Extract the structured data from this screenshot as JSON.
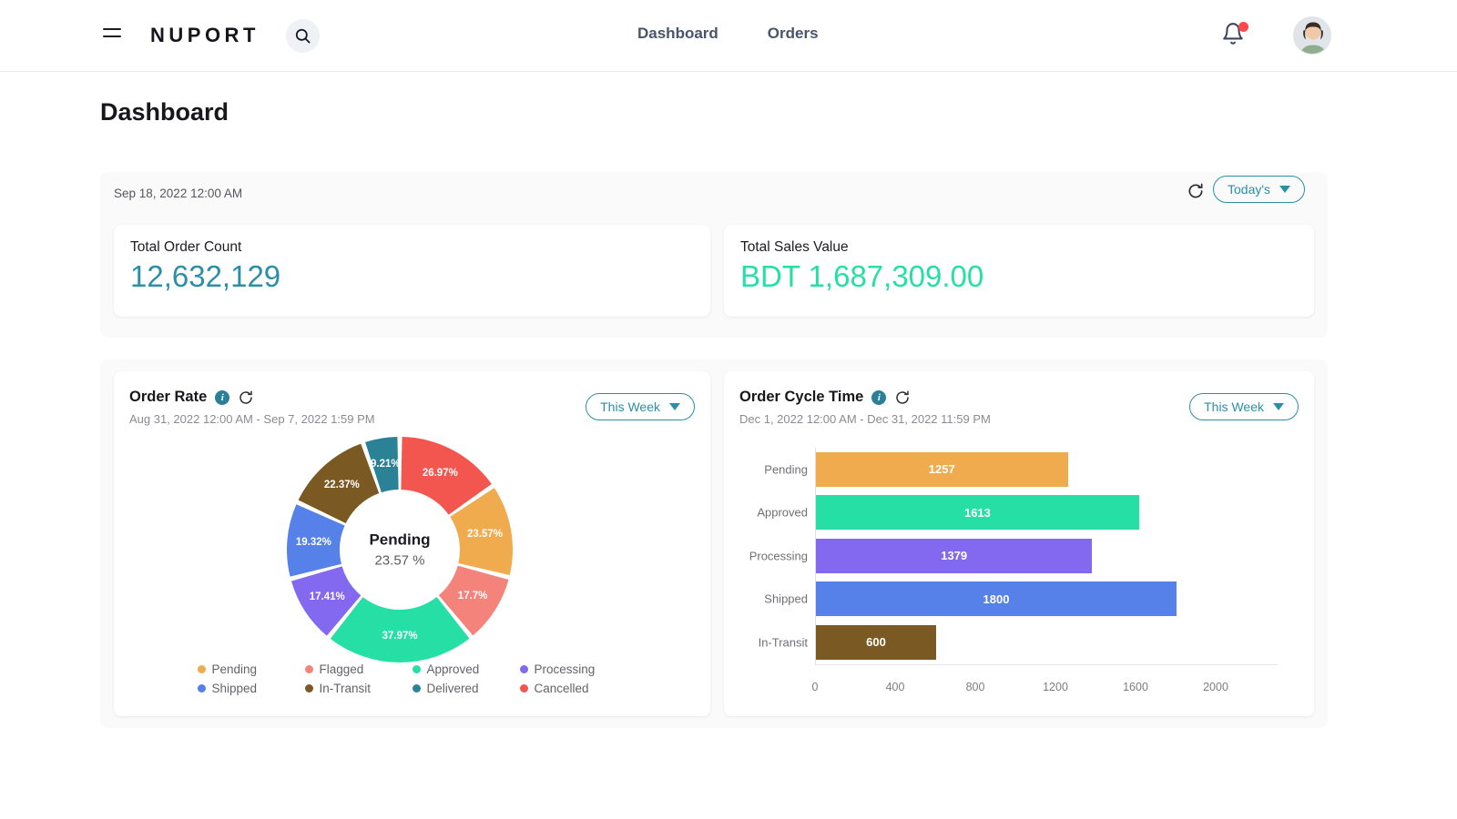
{
  "topbar": {
    "menu_icon": "hamburger-icon",
    "brand": "NUPORT",
    "search_icon": "search-icon",
    "nav": [
      {
        "label": "Dashboard"
      },
      {
        "label": "Orders"
      }
    ],
    "bell_icon": "bell-icon",
    "avatar_icon": "user-avatar"
  },
  "page": {
    "title": "Dashboard"
  },
  "summary": {
    "date": "Sep 18, 2022 12:00 AM",
    "refresh_icon": "refresh-icon",
    "range_filter": "Today's",
    "cards": [
      {
        "label": "Total Order Count",
        "value": "12,632,129",
        "color": "#2b8fa8"
      },
      {
        "label": "Total Sales Value",
        "value": "BDT 1,687,309.00",
        "color": "#25dfa4"
      }
    ]
  },
  "order_rate": {
    "title": "Order Rate",
    "info_icon": "info-icon",
    "refresh_icon": "refresh-icon",
    "subtitle": "Aug 31, 2022 12:00 AM - Sep 7, 2022 1:59 PM",
    "range_filter": "This Week",
    "center": {
      "label": "Pending",
      "value": "23.57 %"
    }
  },
  "order_cycle": {
    "title": "Order Cycle Time",
    "info_icon": "info-icon",
    "refresh_icon": "refresh-icon",
    "subtitle": "Dec 1, 2022 12:00 AM - Dec 31, 2022 11:59 PM",
    "range_filter": "This Week"
  },
  "chart_data": [
    {
      "type": "pie",
      "title": "Order Rate",
      "variant": "donut",
      "center_label": "Pending",
      "center_value": "23.57 %",
      "legend_position": "bottom",
      "labels": [
        "Cancelled",
        "Pending",
        "Flagged",
        "Approved",
        "Processing",
        "Shipped",
        "In-Transit",
        "Delivered"
      ],
      "values": [
        26.97,
        23.57,
        17.7,
        37.97,
        17.41,
        19.32,
        22.37,
        9.21
      ],
      "value_labels": [
        "26.97%",
        "23.57%",
        "17.7%",
        "37.97%",
        "17.41%",
        "19.32%",
        "22.37%",
        "9.21%"
      ],
      "colors": [
        "#f2564f",
        "#efab4d",
        "#f4837c",
        "#25dfa4",
        "#8369ef",
        "#5581e8",
        "#7a5a22",
        "#2b8296"
      ],
      "legend": [
        {
          "label": "Pending",
          "color": "#efab4d"
        },
        {
          "label": "Flagged",
          "color": "#f4837c"
        },
        {
          "label": "Approved",
          "color": "#25dfa4"
        },
        {
          "label": "Processing",
          "color": "#8369ef"
        },
        {
          "label": "Shipped",
          "color": "#5581e8"
        },
        {
          "label": "In-Transit",
          "color": "#7a5a22"
        },
        {
          "label": "Delivered",
          "color": "#2b8296"
        },
        {
          "label": "Cancelled",
          "color": "#f2564f"
        }
      ]
    },
    {
      "type": "bar",
      "orientation": "horizontal",
      "title": "Order Cycle Time",
      "categories": [
        "Pending",
        "Approved",
        "Processing",
        "Shipped",
        "In-Transit"
      ],
      "values": [
        1257,
        1613,
        1379,
        1800,
        600
      ],
      "value_labels": [
        "1257",
        "1613",
        "1379",
        "1800",
        "600"
      ],
      "colors": [
        "#efab4d",
        "#25dfa4",
        "#8369ef",
        "#5581e8",
        "#7a5a22"
      ],
      "xlabel": "",
      "ylabel": "",
      "xlim": [
        0,
        2000
      ],
      "xticks": [
        "0",
        "400",
        "800",
        "1200",
        "1600",
        "2000"
      ],
      "grid": false
    }
  ]
}
